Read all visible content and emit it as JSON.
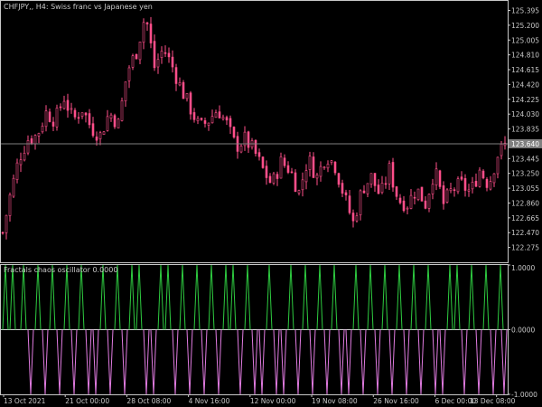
{
  "symbol_title": "CHFJPY,, H4:  Swiss franc vs Japanese yen",
  "indicator_title": "Fractals chaos oscillator 0.0000",
  "colors": {
    "background": "#000000",
    "axis": "#c8c8c8",
    "candle": "#ff4f8a",
    "bid_line": "#808080",
    "osc_up": "#2ecc40",
    "osc_down": "#e07be0",
    "osc_zero": "#cfcfcf"
  },
  "chart_data": [
    {
      "type": "candlestick",
      "title": "CHFJPY,, H4:  Swiss franc vs Japanese yen",
      "ylim": [
        122.08,
        125.52
      ],
      "y_ticks": [
        "125.395",
        "125.200",
        "125.005",
        "124.810",
        "124.615",
        "124.420",
        "124.225",
        "124.030",
        "123.835",
        "123.640",
        "123.445",
        "123.250",
        "123.055",
        "122.860",
        "122.665",
        "122.470",
        "122.275"
      ],
      "current_price_label": "123.640",
      "current_price": 123.64,
      "close_path": [
        [
          0,
          122.35
        ],
        [
          10,
          122.95
        ],
        [
          20,
          123.45
        ],
        [
          30,
          123.7
        ],
        [
          40,
          123.75
        ],
        [
          50,
          124.05
        ],
        [
          60,
          123.95
        ],
        [
          70,
          124.25
        ],
        [
          80,
          123.95
        ],
        [
          90,
          124.1
        ],
        [
          100,
          123.85
        ],
        [
          110,
          123.75
        ],
        [
          120,
          124.05
        ],
        [
          130,
          123.9
        ],
        [
          140,
          124.6
        ],
        [
          150,
          124.85
        ],
        [
          160,
          125.35
        ],
        [
          170,
          124.65
        ],
        [
          180,
          124.9
        ],
        [
          190,
          124.65
        ],
        [
          200,
          124.35
        ],
        [
          210,
          124.1
        ],
        [
          220,
          123.85
        ],
        [
          230,
          123.95
        ],
        [
          240,
          124.1
        ],
        [
          250,
          123.9
        ],
        [
          260,
          123.6
        ],
        [
          270,
          123.7
        ],
        [
          280,
          123.55
        ],
        [
          290,
          123.3
        ],
        [
          300,
          123.1
        ],
        [
          310,
          123.4
        ],
        [
          320,
          123.3
        ],
        [
          330,
          123.0
        ],
        [
          340,
          123.45
        ],
        [
          350,
          123.2
        ],
        [
          360,
          123.5
        ],
        [
          370,
          123.35
        ],
        [
          380,
          122.95
        ],
        [
          390,
          122.6
        ],
        [
          400,
          123.05
        ],
        [
          410,
          123.2
        ],
        [
          420,
          122.95
        ],
        [
          430,
          123.3
        ],
        [
          440,
          122.9
        ],
        [
          450,
          122.85
        ],
        [
          460,
          123.05
        ],
        [
          470,
          122.85
        ],
        [
          480,
          123.3
        ],
        [
          490,
          122.85
        ],
        [
          500,
          123.05
        ],
        [
          510,
          123.1
        ],
        [
          520,
          123.0
        ],
        [
          530,
          123.3
        ],
        [
          540,
          123.1
        ],
        [
          550,
          123.5
        ],
        [
          560,
          123.65
        ]
      ],
      "x_ticks": [
        "13 Oct 2021",
        "21 Oct 00:00",
        "28 Oct 08:00",
        "4 Nov 16:00",
        "12 Nov 00:00",
        "19 Nov 08:00",
        "26 Nov 16:00",
        "6 Dec 00:00",
        "13 Dec 08:00"
      ]
    },
    {
      "type": "line",
      "title": "Fractals chaos oscillator 0.0000",
      "ylim": [
        -1,
        1
      ],
      "y_ticks": [
        "1.0000",
        "0.0000",
        "-1.0000"
      ],
      "signals": [
        [
          6,
          1
        ],
        [
          14,
          1
        ],
        [
          26,
          1
        ],
        [
          34,
          -1
        ],
        [
          42,
          1
        ],
        [
          50,
          -1
        ],
        [
          58,
          1
        ],
        [
          66,
          -1
        ],
        [
          74,
          1
        ],
        [
          82,
          -1
        ],
        [
          90,
          1
        ],
        [
          98,
          -1
        ],
        [
          106,
          -1
        ],
        [
          114,
          1
        ],
        [
          122,
          -1
        ],
        [
          130,
          1
        ],
        [
          138,
          -1
        ],
        [
          146,
          1
        ],
        [
          154,
          1
        ],
        [
          162,
          -1
        ],
        [
          170,
          -1
        ],
        [
          178,
          1
        ],
        [
          186,
          1
        ],
        [
          194,
          -1
        ],
        [
          202,
          1
        ],
        [
          210,
          -1
        ],
        [
          218,
          1
        ],
        [
          226,
          -1
        ],
        [
          234,
          1
        ],
        [
          242,
          -1
        ],
        [
          250,
          1
        ],
        [
          258,
          1
        ],
        [
          266,
          -1
        ],
        [
          274,
          1
        ],
        [
          282,
          -1
        ],
        [
          290,
          -1
        ],
        [
          298,
          1
        ],
        [
          306,
          -1
        ],
        [
          314,
          -1
        ],
        [
          322,
          1
        ],
        [
          330,
          -1
        ],
        [
          338,
          1
        ],
        [
          346,
          -1
        ],
        [
          354,
          1
        ],
        [
          362,
          -1
        ],
        [
          370,
          1
        ],
        [
          378,
          -1
        ],
        [
          386,
          -1
        ],
        [
          394,
          1
        ],
        [
          402,
          -1
        ],
        [
          410,
          1
        ],
        [
          418,
          -1
        ],
        [
          426,
          1
        ],
        [
          434,
          -1
        ],
        [
          442,
          1
        ],
        [
          450,
          -1
        ],
        [
          458,
          1
        ],
        [
          466,
          -1
        ],
        [
          474,
          1
        ],
        [
          482,
          -1
        ],
        [
          490,
          -1
        ],
        [
          498,
          1
        ],
        [
          506,
          1
        ],
        [
          514,
          -1
        ],
        [
          522,
          1
        ],
        [
          530,
          -1
        ],
        [
          538,
          1
        ],
        [
          546,
          -1
        ],
        [
          554,
          1
        ],
        [
          558,
          -1
        ]
      ]
    }
  ]
}
